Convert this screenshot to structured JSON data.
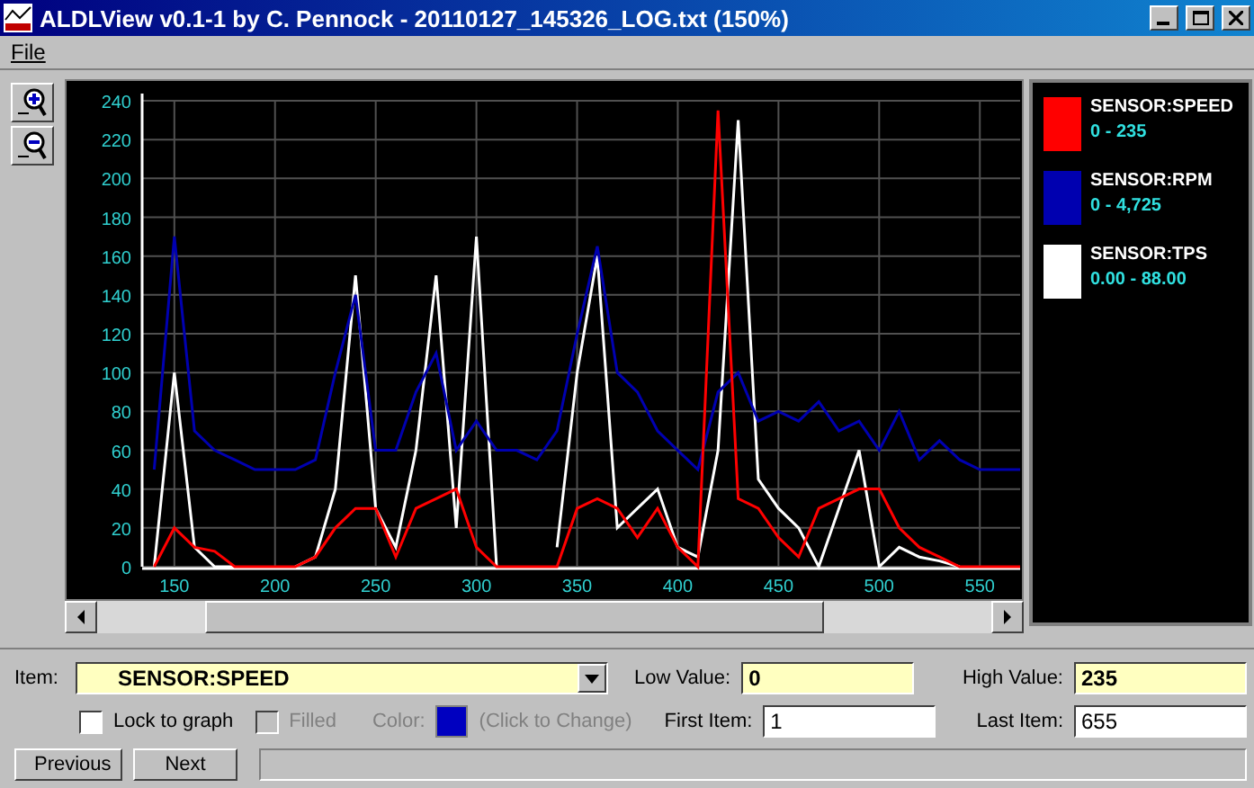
{
  "window": {
    "title": "ALDLView v0.1-1 by C. Pennock - 20110127_145326_LOG.txt (150%)"
  },
  "menu": [
    {
      "label": "File"
    }
  ],
  "chart": {
    "chart_data": {
      "type": "line",
      "grid": true,
      "x": [
        140,
        150,
        160,
        170,
        180,
        190,
        200,
        210,
        220,
        230,
        240,
        250,
        260,
        270,
        280,
        290,
        300,
        310,
        320,
        330,
        340,
        350,
        360,
        370,
        380,
        390,
        400,
        410,
        420,
        430,
        440,
        450,
        460,
        470,
        480,
        490,
        500,
        510,
        520,
        530,
        540,
        550,
        560,
        570
      ],
      "xlim": [
        134,
        570
      ],
      "ylim": [
        0,
        240
      ],
      "xticks": [
        150,
        200,
        250,
        300,
        350,
        400,
        450,
        500,
        550
      ],
      "yticks": [
        0,
        20,
        40,
        60,
        80,
        100,
        120,
        140,
        160,
        180,
        200,
        220,
        240
      ],
      "series": [
        {
          "name": "SENSOR:SPEED",
          "color": "#ff0000",
          "values": [
            0,
            20,
            10,
            8,
            0,
            0,
            0,
            0,
            5,
            20,
            30,
            30,
            5,
            30,
            35,
            40,
            10,
            0,
            0,
            0,
            0,
            30,
            35,
            30,
            15,
            30,
            10,
            0,
            235,
            35,
            30,
            15,
            5,
            30,
            35,
            40,
            40,
            20,
            10,
            5,
            0,
            0,
            0,
            0
          ]
        },
        {
          "name": "SENSOR:RPM",
          "color": "#0000b0",
          "values": [
            50,
            170,
            70,
            60,
            55,
            50,
            50,
            50,
            55,
            100,
            140,
            60,
            60,
            90,
            110,
            60,
            75,
            60,
            60,
            55,
            70,
            120,
            165,
            100,
            90,
            70,
            60,
            50,
            90,
            100,
            75,
            80,
            75,
            85,
            70,
            75,
            60,
            80,
            55,
            65,
            55,
            50,
            50,
            50
          ]
        },
        {
          "name": "SENSOR:TPS",
          "color": "#ffffff",
          "values": [
            0,
            100,
            10,
            0,
            0,
            null,
            null,
            0,
            5,
            40,
            150,
            30,
            10,
            60,
            150,
            20,
            170,
            0,
            null,
            null,
            10,
            100,
            160,
            20,
            30,
            40,
            10,
            5,
            60,
            230,
            45,
            30,
            20,
            0,
            30,
            60,
            0,
            10,
            5,
            3,
            0,
            null,
            null,
            null
          ]
        }
      ]
    }
  },
  "legend": [
    {
      "range": "0 - 235"
    },
    {
      "range": "0 - 4,725"
    },
    {
      "range": "0.00 - 88.00"
    }
  ],
  "controls": {
    "item_label": "Item:",
    "item_value": "SENSOR:SPEED",
    "lock_to_graph": {
      "label": "Lock to graph",
      "checked": false
    },
    "filled": {
      "label": "Filled",
      "checked": false,
      "disabled": true
    },
    "color_label": "Color:",
    "color": "#0000c0",
    "color_hint": "(Click to Change)",
    "low_value_label": "Low Value:",
    "low_value": "0",
    "high_value_label": "High Value:",
    "high_value": "235",
    "first_item_label": "First Item:",
    "first_item": "1",
    "last_item_label": "Last Item:",
    "last_item": "655"
  },
  "buttons": [
    {
      "label": "Previous"
    },
    {
      "label": "Next"
    }
  ]
}
